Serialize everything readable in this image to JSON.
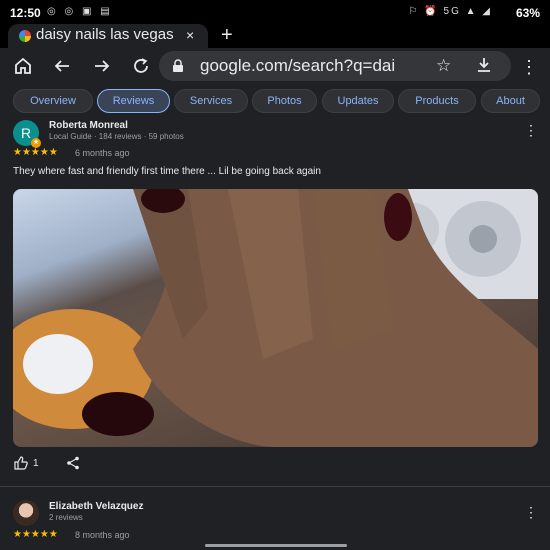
{
  "status_bar": {
    "time": "12:50",
    "left_icons": "◎ ◎ ▣ ▤",
    "right_icons": "⚐ ⏰ 5G ▲ ◢",
    "battery": "63%"
  },
  "tab": {
    "title": "daisy nails las vegas",
    "close": "×",
    "new_tab": "+"
  },
  "toolbar": {
    "url": "google.com/search?q=dai"
  },
  "chips": [
    {
      "label": "Overview",
      "active": false
    },
    {
      "label": "Reviews",
      "active": true
    },
    {
      "label": "Services",
      "active": false
    },
    {
      "label": "Photos",
      "active": false
    },
    {
      "label": "Updates",
      "active": false
    },
    {
      "label": "Products",
      "active": false
    },
    {
      "label": "About",
      "active": false
    }
  ],
  "reviews": [
    {
      "avatar_letter": "R",
      "name": "Roberta Monreal",
      "meta": "Local Guide · 184 reviews · 59 photos",
      "rating": 5,
      "stars": "★★★★★",
      "date": "6 months ago",
      "text": "They where fast and friendly first time there ... Lil be going back again",
      "likes": "1"
    },
    {
      "name": "Elizabeth Velazquez",
      "meta": "2 reviews",
      "rating": 5,
      "stars": "★★★★★",
      "date": "8 months ago"
    }
  ],
  "colors": {
    "background": "#202124",
    "chip_text": "#8ab4f8",
    "star": "#fbbc04"
  }
}
